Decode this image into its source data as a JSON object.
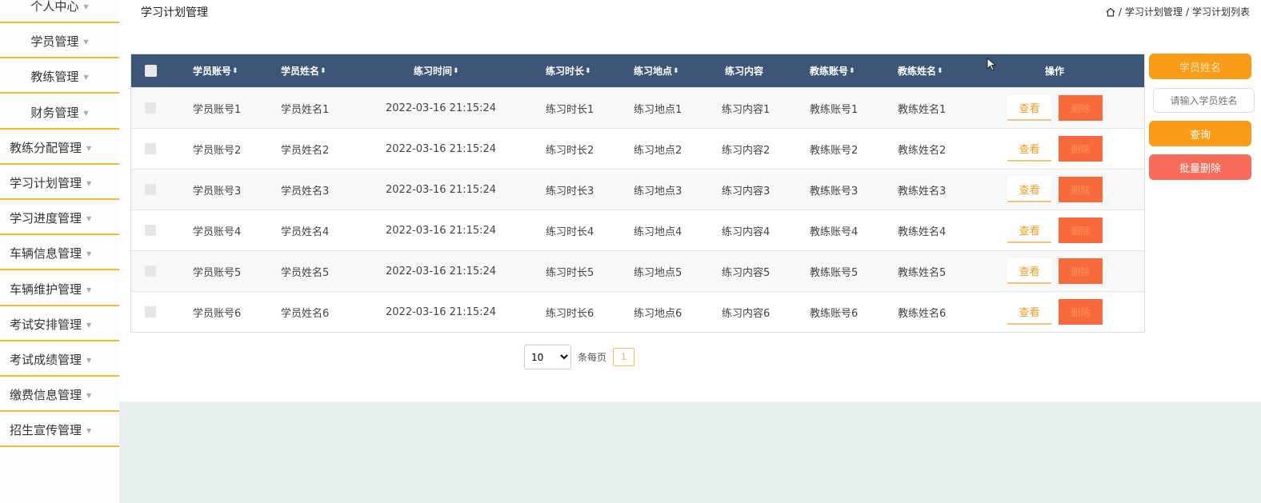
{
  "sidebar": {
    "items": [
      {
        "label": "个人中心"
      },
      {
        "label": "学员管理"
      },
      {
        "label": "教练管理"
      },
      {
        "label": "财务管理"
      },
      {
        "label": "教练分配管理"
      },
      {
        "label": "学习计划管理"
      },
      {
        "label": "学习进度管理"
      },
      {
        "label": "车辆信息管理"
      },
      {
        "label": "车辆维护管理"
      },
      {
        "label": "考试安排管理"
      },
      {
        "label": "考试成绩管理"
      },
      {
        "label": "缴费信息管理"
      },
      {
        "label": "招生宣传管理"
      }
    ],
    "caret": "▼"
  },
  "header": {
    "title": "学习计划管理",
    "breadcrumb": [
      "学习计划管理",
      "学习计划列表"
    ],
    "separator": "/"
  },
  "table": {
    "columns": [
      "学员账号",
      "学员姓名",
      "练习时间",
      "练习时长",
      "练习地点",
      "练习内容",
      "教练账号",
      "教练姓名",
      "操作"
    ],
    "sort_glyph": "⬍",
    "rows": [
      {
        "account": "学员账号1",
        "name": "学员姓名1",
        "time": "2022-03-16 21:15:24",
        "duration": "练习时长1",
        "place": "练习地点1",
        "content": "练习内容1",
        "coach_account": "教练账号1",
        "coach_name": "教练姓名1"
      },
      {
        "account": "学员账号2",
        "name": "学员姓名2",
        "time": "2022-03-16 21:15:24",
        "duration": "练习时长2",
        "place": "练习地点2",
        "content": "练习内容2",
        "coach_account": "教练账号2",
        "coach_name": "教练姓名2"
      },
      {
        "account": "学员账号3",
        "name": "学员姓名3",
        "time": "2022-03-16 21:15:24",
        "duration": "练习时长3",
        "place": "练习地点3",
        "content": "练习内容3",
        "coach_account": "教练账号3",
        "coach_name": "教练姓名3"
      },
      {
        "account": "学员账号4",
        "name": "学员姓名4",
        "time": "2022-03-16 21:15:24",
        "duration": "练习时长4",
        "place": "练习地点4",
        "content": "练习内容4",
        "coach_account": "教练账号4",
        "coach_name": "教练姓名4"
      },
      {
        "account": "学员账号5",
        "name": "学员姓名5",
        "time": "2022-03-16 21:15:24",
        "duration": "练习时长5",
        "place": "练习地点5",
        "content": "练习内容5",
        "coach_account": "教练账号5",
        "coach_name": "教练姓名5"
      },
      {
        "account": "学员账号6",
        "name": "学员姓名6",
        "time": "2022-03-16 21:15:24",
        "duration": "练习时长6",
        "place": "练习地点6",
        "content": "练习内容6",
        "coach_account": "教练账号6",
        "coach_name": "教练姓名6"
      }
    ],
    "view_label": "查看",
    "delete_label": "删除"
  },
  "pagination": {
    "page_size": "10",
    "page_size_options": [
      "10"
    ],
    "per_page_label": "条每页",
    "current_page": "1"
  },
  "search_panel": {
    "field_label": "学员姓名",
    "input_placeholder": "请输入学员姓名",
    "search_label": "查询",
    "batch_delete_label": "批量删除"
  },
  "colors": {
    "table_header": "#3d5678",
    "accent_orange": "#fb9c18",
    "danger": "#f86a3c",
    "sidebar_divider": "#f5b731"
  }
}
